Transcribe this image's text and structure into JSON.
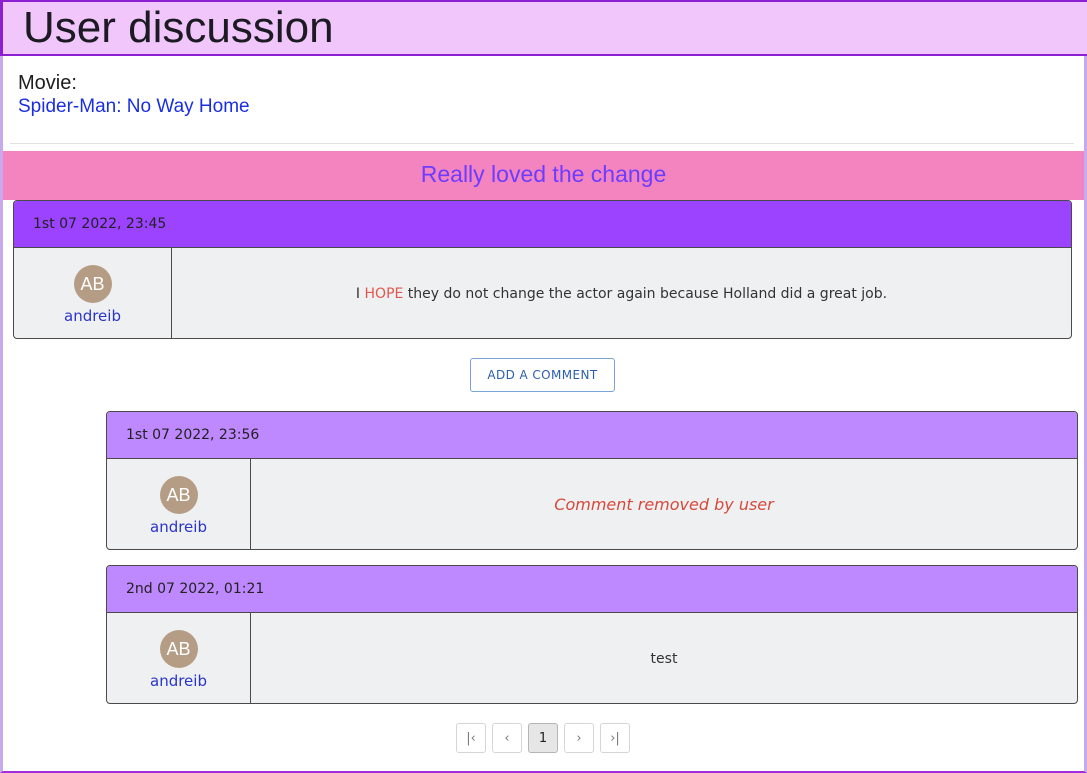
{
  "header": {
    "title": "User discussion"
  },
  "movie": {
    "label": "Movie:",
    "title": "Spider-Man: No Way Home"
  },
  "topic": {
    "title": "Really loved the change"
  },
  "main_post": {
    "date": "1st 07 2022, 23:45",
    "avatar_initials": "AB",
    "username": "andreib",
    "message_before": "I ",
    "message_highlight": "HOPE",
    "message_after": " they do not change the actor again because Holland did a great job."
  },
  "add_comment_label": "ADD A COMMENT",
  "replies": [
    {
      "date": "1st 07 2022, 23:56",
      "avatar_initials": "AB",
      "username": "andreib",
      "message": "Comment removed by user"
    },
    {
      "date": "2nd 07 2022, 01:21",
      "avatar_initials": "AB",
      "username": "andreib",
      "message": "test"
    }
  ],
  "pagination": {
    "first": "|‹",
    "prev": "‹",
    "current": "1",
    "next": "›",
    "last": "›|"
  },
  "colors": {
    "header_bg": "#f1c6fb",
    "topic_bg": "#f484bf",
    "main_post_head": "#9b43fe",
    "reply_head": "#be88fe",
    "link": "#1a2fe0",
    "avatar": "#b59d85"
  }
}
